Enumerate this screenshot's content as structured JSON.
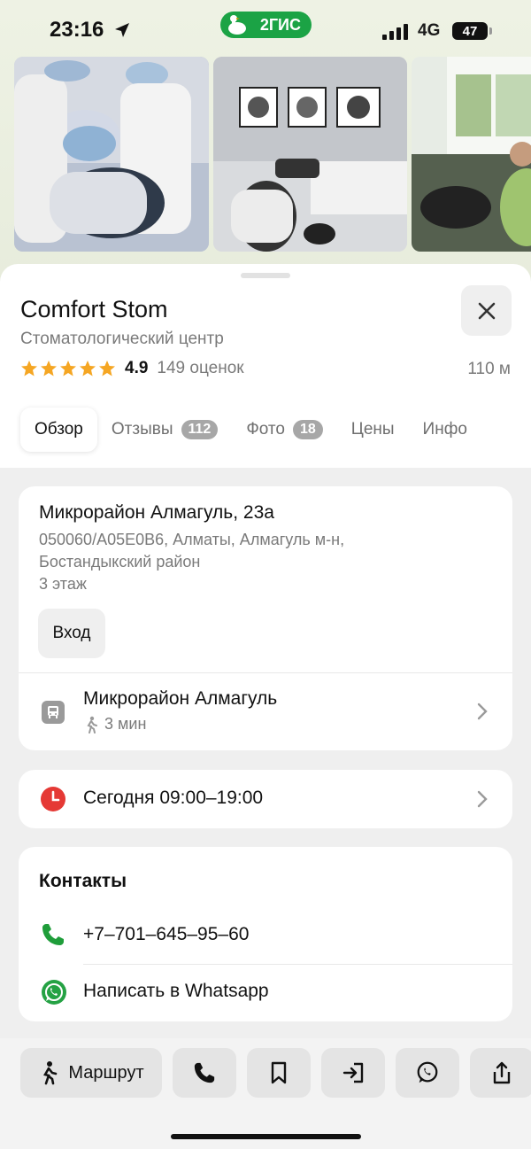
{
  "status_bar": {
    "time": "23:16",
    "network": "4G",
    "battery": "47",
    "brand": "2ГИС"
  },
  "place": {
    "title": "Comfort Stom",
    "category": "Стоматологический центр",
    "rating": "4.9",
    "rating_count": "149 оценок",
    "distance": "110 м",
    "stars": 5
  },
  "tabs": [
    {
      "label": "Обзор",
      "badge": null,
      "active": true
    },
    {
      "label": "Отзывы",
      "badge": "112",
      "active": false
    },
    {
      "label": "Фото",
      "badge": "18",
      "active": false
    },
    {
      "label": "Цены",
      "badge": null,
      "active": false
    },
    {
      "label": "Инфо",
      "badge": null,
      "active": false
    }
  ],
  "address": {
    "main": "Микрорайон Алмагуль, 23а",
    "line1": "050060/A05E0B6, Алматы, Алмагуль м-н,",
    "line2": "Бостандыкский район",
    "floor": "3 этаж",
    "entrance_label": "Вход"
  },
  "stop": {
    "name": "Микрорайон Алмагуль",
    "walk_time": "3 мин"
  },
  "hours": {
    "text": "Сегодня 09:00–19:00"
  },
  "contacts": {
    "title": "Контакты",
    "phone": "+7‒701‒645‒95‒60",
    "whatsapp": "Написать в Whatsapp"
  },
  "bottom_bar": {
    "route_label": "Маршрут",
    "icons": [
      "phone-icon",
      "bookmark-icon",
      "entrance-icon",
      "whatsapp-icon",
      "share-icon"
    ]
  },
  "colors": {
    "brand_green": "#1ba345",
    "star": "#f5a623",
    "clock_red": "#e53935",
    "phone_green": "#1f9d3a",
    "whatsapp_green": "#25a244"
  }
}
